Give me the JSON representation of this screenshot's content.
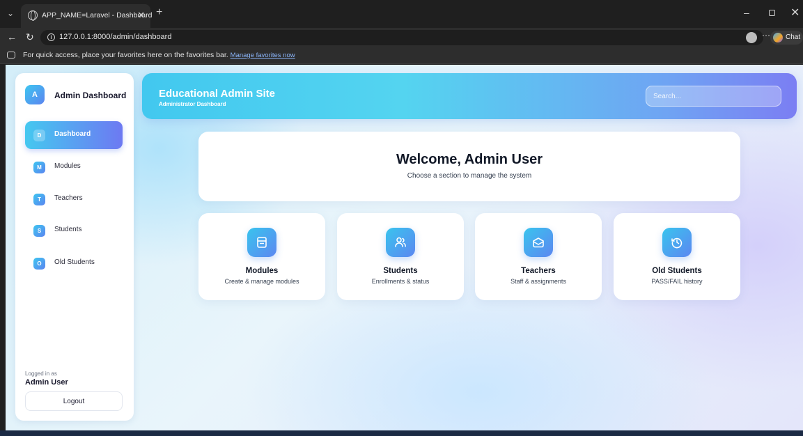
{
  "browser": {
    "tab_title": "APP_NAME=Laravel - Dashboard",
    "url": "127.0.0.1:8000/admin/dashboard",
    "favorites_text": "For quick access, place your favorites here on the favorites bar.",
    "favorites_link": "Manage favorites now",
    "copilot_label": "Chat"
  },
  "sidebar": {
    "brand_initial": "A",
    "brand_name": "Admin Dashboard",
    "items": [
      {
        "initial": "D",
        "label": "Dashboard",
        "active": true
      },
      {
        "initial": "M",
        "label": "Modules",
        "active": false
      },
      {
        "initial": "T",
        "label": "Teachers",
        "active": false
      },
      {
        "initial": "S",
        "label": "Students",
        "active": false
      },
      {
        "initial": "O",
        "label": "Old Students",
        "active": false
      }
    ],
    "logged_in_label": "Logged in as",
    "user_name": "Admin User",
    "logout_label": "Logout"
  },
  "header": {
    "title": "Educational Admin Site",
    "subtitle": "Administrator Dashboard",
    "search_placeholder": "Search..."
  },
  "welcome": {
    "title": "Welcome, Admin User",
    "subtitle": "Choose a section to manage the system"
  },
  "cards": [
    {
      "title": "Modules",
      "desc": "Create & manage modules",
      "icon": "modules-icon"
    },
    {
      "title": "Students",
      "desc": "Enrollments & status",
      "icon": "students-icon"
    },
    {
      "title": "Teachers",
      "desc": "Staff & assignments",
      "icon": "teachers-icon"
    },
    {
      "title": "Old Students",
      "desc": "PASS/FAIL history",
      "icon": "history-icon"
    }
  ],
  "colors": {
    "accent_start": "#42c8ef",
    "accent_end": "#7b7ef3"
  }
}
